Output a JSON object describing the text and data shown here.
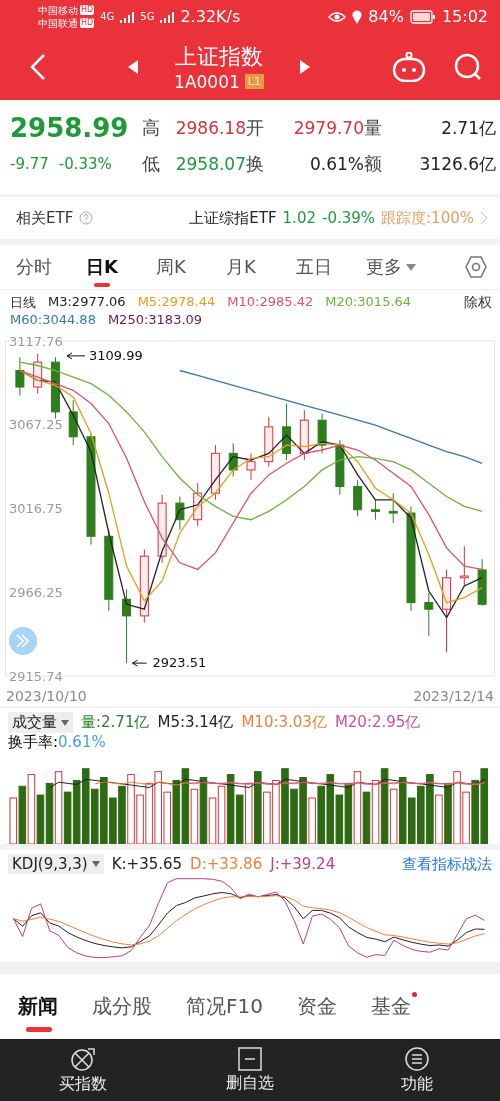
{
  "status_bar": {
    "carrier_1": "中国移动",
    "hd_1": "HD",
    "carrier_2": "中国联通",
    "hd_2": "HD",
    "net_1": "4G",
    "net_2": "5G",
    "speed": "2.32K/s",
    "battery": "84%",
    "time": "15:02"
  },
  "header": {
    "title": "上证指数",
    "code": "1A0001",
    "level_badge": "L1"
  },
  "quote": {
    "price": "2958.99",
    "change": "-9.77",
    "change_pct": "-0.33%",
    "stats": [
      {
        "label": "高",
        "value": "2986.18",
        "color": "#d6333d"
      },
      {
        "label": "开",
        "value": "2979.70",
        "color": "#d6333d"
      },
      {
        "label": "量",
        "value": "2.71亿",
        "color": "#222222"
      },
      {
        "label": "低",
        "value": "2958.07",
        "color": "#1f9a3a"
      },
      {
        "label": "换",
        "value": "0.61%",
        "color": "#222222"
      },
      {
        "label": "额",
        "value": "3126.6亿",
        "color": "#222222"
      }
    ]
  },
  "etf": {
    "label": "相关ETF",
    "name": "上证综指ETF",
    "price": "1.02",
    "change_pct": "-0.39%",
    "tracking": "跟踪度:100%"
  },
  "period_tabs": [
    {
      "label": "分时",
      "selected": false,
      "dropdown": false
    },
    {
      "label": "日K",
      "selected": true,
      "dropdown": false
    },
    {
      "label": "周K",
      "selected": false,
      "dropdown": false
    },
    {
      "label": "月K",
      "selected": false,
      "dropdown": false
    },
    {
      "label": "五日",
      "selected": false,
      "dropdown": false
    },
    {
      "label": "更多",
      "selected": false,
      "dropdown": true
    }
  ],
  "legend": {
    "period": "日线",
    "adjust": "除权",
    "ma": [
      {
        "label": "M3:2977.06",
        "color": "#222222"
      },
      {
        "label": "M5:2978.44",
        "color": "#e0a020"
      },
      {
        "label": "M10:2985.42",
        "color": "#e05070"
      },
      {
        "label": "M20:3015.64",
        "color": "#70b040"
      },
      {
        "label": "M60:3044.88",
        "color": "#3a78a8"
      },
      {
        "label": "M250:3183.09",
        "color": "#6a1a50"
      }
    ]
  },
  "kline": {
    "max_label": "3109.99",
    "min_label": "2923.51",
    "start_date": "2023/10/10",
    "end_date": "2023/12/14",
    "chart_data": {
      "type": "candlestick",
      "ylim": [
        2915.74,
        3117.76
      ],
      "ohlc": [
        [
          3100,
          3108,
          3085,
          3090
        ],
        [
          3090,
          3109.99,
          3086,
          3105
        ],
        [
          3105,
          3108,
          3070,
          3075
        ],
        [
          3075,
          3082,
          3055,
          3060
        ],
        [
          3060,
          3062,
          2995,
          3000
        ],
        [
          3000,
          3004,
          2955,
          2962
        ],
        [
          2962,
          2968,
          2923.51,
          2952
        ],
        [
          2952,
          2992,
          2948,
          2988
        ],
        [
          2988,
          3025,
          2984,
          3020
        ],
        [
          3020,
          3024,
          3004,
          3010
        ],
        [
          3010,
          3032,
          3006,
          3026
        ],
        [
          3026,
          3055,
          3022,
          3050
        ],
        [
          3050,
          3056,
          3036,
          3040
        ],
        [
          3040,
          3050,
          3034,
          3045
        ],
        [
          3045,
          3072,
          3042,
          3066
        ],
        [
          3066,
          3080,
          3046,
          3050
        ],
        [
          3050,
          3076,
          3046,
          3070
        ],
        [
          3070,
          3074,
          3050,
          3055
        ],
        [
          3055,
          3058,
          3025,
          3030
        ],
        [
          3030,
          3034,
          3012,
          3016
        ],
        [
          3016,
          3022,
          3010,
          3015
        ],
        [
          3015,
          3026,
          3008,
          3014
        ],
        [
          3014,
          3018,
          2955,
          2960
        ],
        [
          2960,
          2966,
          2940,
          2956
        ],
        [
          2956,
          2980,
          2930,
          2975
        ],
        [
          2975,
          2994,
          2970,
          2976
        ],
        [
          2979.7,
          2986.18,
          2958.07,
          2958.99
        ]
      ],
      "categories": [
        null,
        null,
        null,
        null,
        null,
        null,
        null,
        null,
        null,
        null,
        null,
        null,
        null,
        null,
        null,
        null,
        null,
        null,
        null,
        null,
        null,
        null,
        null,
        null,
        null,
        null,
        null
      ],
      "yticks": [
        {
          "value": 3117.76,
          "label": "3117.76"
        },
        {
          "value": 3067.25,
          "label": "3067.25"
        },
        {
          "value": 3016.75,
          "label": "3016.75"
        },
        {
          "value": 2966.25,
          "label": "2966.25"
        },
        {
          "value": 2915.74,
          "label": "2915.74"
        }
      ],
      "series": [
        {
          "type": "line",
          "color": "#222222",
          "values": [
            3100,
            3094,
            3093,
            3073,
            3051,
            3002,
            2959,
            2956,
            2991,
            3016,
            3019,
            3034,
            3048,
            3046,
            3050,
            3061,
            3050,
            3057,
            3055,
            3037,
            3022,
            3022,
            3011,
            2967,
            2951,
            2970,
            2975
          ]
        },
        {
          "type": "line",
          "color": "#e0a020",
          "values": [
            3100,
            3094,
            3091,
            3084,
            3062,
            3026,
            2982,
            2961,
            2973,
            3002,
            3018,
            3026,
            3040,
            3047,
            3048,
            3055,
            3054,
            3056,
            3055,
            3045,
            3029,
            3022,
            3014,
            2989,
            2960,
            2963,
            2969
          ]
        },
        {
          "type": "line",
          "color": "#e05070",
          "values": [
            3100,
            3096,
            3092,
            3088,
            3080,
            3068,
            3047,
            3021,
            2999,
            2984,
            2980,
            2990,
            3008,
            3026,
            3037,
            3044,
            3050,
            3052,
            3055,
            3052,
            3046,
            3038,
            3030,
            3013,
            2993,
            2982,
            2980
          ]
        },
        {
          "type": "line",
          "color": "#70b040",
          "values": [
            3105,
            3103,
            3100,
            3096,
            3092,
            3085,
            3075,
            3063,
            3048,
            3035,
            3025,
            3018,
            3012,
            3010,
            3015,
            3022,
            3030,
            3040,
            3046,
            3048,
            3047,
            3045,
            3040,
            3032,
            3024,
            3018,
            3015
          ]
        },
        {
          "type": "line",
          "color": "#3a78a8",
          "values": [
            null,
            null,
            null,
            null,
            null,
            null,
            null,
            null,
            null,
            3100,
            3097,
            3094,
            3091,
            3088,
            3085,
            3082,
            3079,
            3076,
            3073,
            3070,
            3067,
            3063,
            3059,
            3055,
            3051,
            3048,
            3044
          ]
        }
      ]
    }
  },
  "volume": {
    "selector": "成交量",
    "turnover_label": "换手率:",
    "turnover_value": "0.61%",
    "items": [
      {
        "label": "量:2.71亿",
        "color": "#2e7d32"
      },
      {
        "label": "M5:3.14亿",
        "color": "#222222"
      },
      {
        "label": "M10:3.03亿",
        "color": "#f08040"
      },
      {
        "label": "M20:2.95亿",
        "color": "#d0508a"
      }
    ]
  },
  "kdj": {
    "selector": "KDJ(9,3,3)",
    "link": "查看指标战法",
    "items": [
      {
        "label": "K:+35.65",
        "color": "#222222"
      },
      {
        "label": "D:+33.86",
        "color": "#f08040"
      },
      {
        "label": "J:+39.24",
        "color": "#c04080"
      }
    ]
  },
  "news_tabs": [
    {
      "label": "新闻",
      "selected": true,
      "dot": false
    },
    {
      "label": "成分股",
      "selected": false,
      "dot": false
    },
    {
      "label": "简况F10",
      "selected": false,
      "dot": false
    },
    {
      "label": "资金",
      "selected": false,
      "dot": false
    },
    {
      "label": "基金",
      "selected": false,
      "dot": true
    }
  ],
  "bottom_bar": [
    {
      "label": "买指数",
      "kind": "buy"
    },
    {
      "label": "删自选",
      "kind": "remove"
    },
    {
      "label": "功能",
      "kind": "menu"
    }
  ]
}
